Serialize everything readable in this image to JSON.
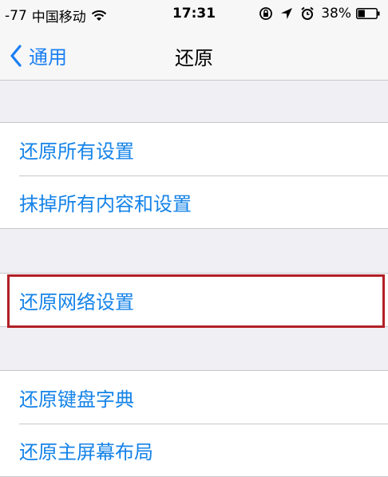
{
  "status_bar": {
    "signal": "-77",
    "carrier": "中国移动",
    "wifi_icon": "wifi-icon",
    "time": "17:31",
    "battery_percent": "38%",
    "battery_level": 0.38,
    "icons": [
      "rotation-lock-icon",
      "location-arrow-icon",
      "alarm-icon",
      "battery-icon"
    ]
  },
  "nav": {
    "back_label": "通用",
    "title": "还原"
  },
  "groups": [
    {
      "items": [
        "还原所有设置",
        "抹掉所有内容和设置"
      ]
    },
    {
      "items": [
        "还原网络设置"
      ]
    },
    {
      "items": [
        "还原键盘字典",
        "还原主屏幕布局"
      ]
    }
  ],
  "colors": {
    "link": "#1583e8",
    "highlight": "#b31f26",
    "background": "#efeff4"
  }
}
